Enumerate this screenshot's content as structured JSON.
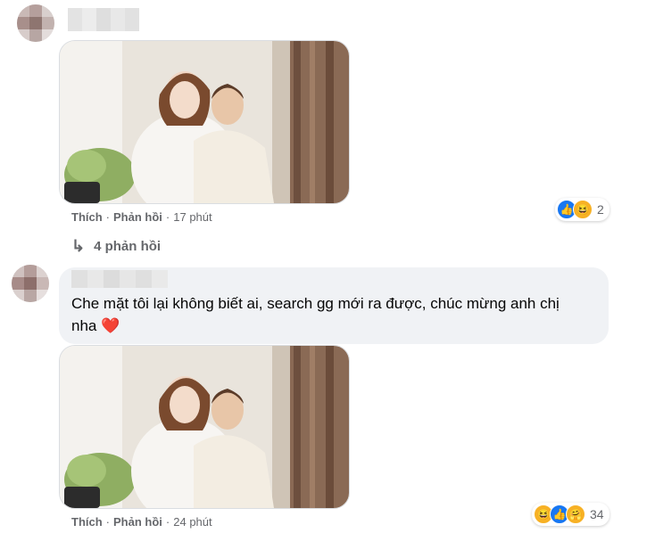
{
  "comments": [
    {
      "meta": {
        "like": "Thích",
        "reply": "Phản hồi",
        "time": "17 phút"
      },
      "replies_link": "4 phản hồi",
      "reactions": {
        "icons": [
          "like-icon",
          "haha-icon"
        ],
        "count": "2"
      }
    },
    {
      "text_body": "Che mặt tôi lại không biết ai, search gg mới ra được, chúc mừng anh chị nha",
      "text_emoji": "❤️",
      "meta": {
        "like": "Thích",
        "reply": "Phản hồi",
        "time": "24 phút"
      },
      "reactions": {
        "icons": [
          "haha-icon",
          "like-icon",
          "care-icon"
        ],
        "count": "34"
      }
    }
  ],
  "colors": {
    "bubble": "#f0f2f5",
    "meta_text": "#65676b",
    "like_blue": "#1877f2",
    "heart": "#e0245e"
  }
}
